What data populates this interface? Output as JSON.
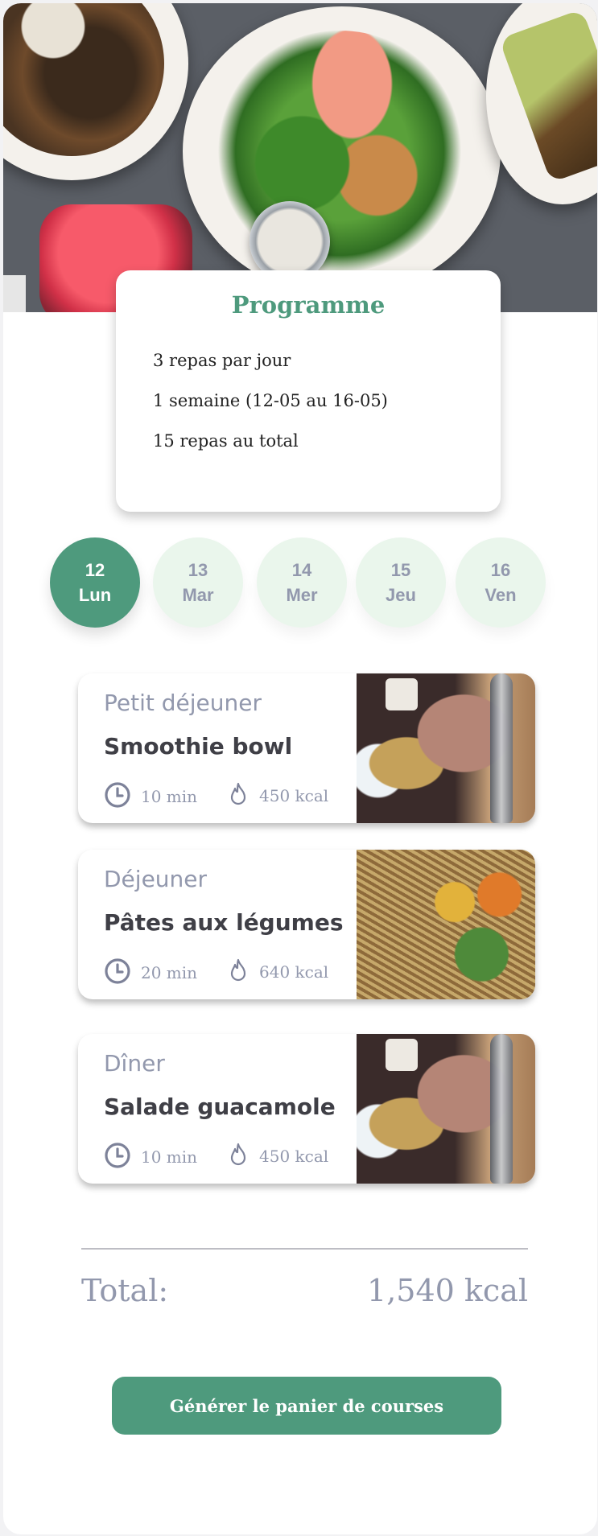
{
  "programme": {
    "title": "Programme",
    "lines": [
      "3 repas par jour",
      "1 semaine (12-05 au 16-05)",
      "15 repas au total"
    ]
  },
  "days": [
    {
      "num": "12",
      "label": "Lun",
      "active": true
    },
    {
      "num": "13",
      "label": "Mar",
      "active": false
    },
    {
      "num": "14",
      "label": "Mer",
      "active": false
    },
    {
      "num": "15",
      "label": "Jeu",
      "active": false
    },
    {
      "num": "16",
      "label": "Ven",
      "active": false
    }
  ],
  "meals": [
    {
      "type": "Petit déjeuner",
      "name": "Smoothie bowl",
      "time": "10 min",
      "kcal": "450 kcal",
      "photo": "smoothie-bowl-photo"
    },
    {
      "type": "Déjeuner",
      "name": "Pâtes aux légumes",
      "time": "20 min",
      "kcal": "640 kcal",
      "photo": "pasta-vegetables-photo"
    },
    {
      "type": "Dîner",
      "name": "Salade guacamole",
      "time": "10 min",
      "kcal": "450 kcal",
      "photo": "smoothie-bowl-photo"
    }
  ],
  "total": {
    "label": "Total:",
    "value": "1,540 kcal"
  },
  "cta": {
    "label": "Générer le panier de courses"
  },
  "icons": {
    "time": "clock-icon",
    "calories": "flame-icon"
  },
  "colors": {
    "accent": "#4e9a7d",
    "muted": "#9298ad",
    "day_inactive_bg": "#eaf6ec"
  }
}
